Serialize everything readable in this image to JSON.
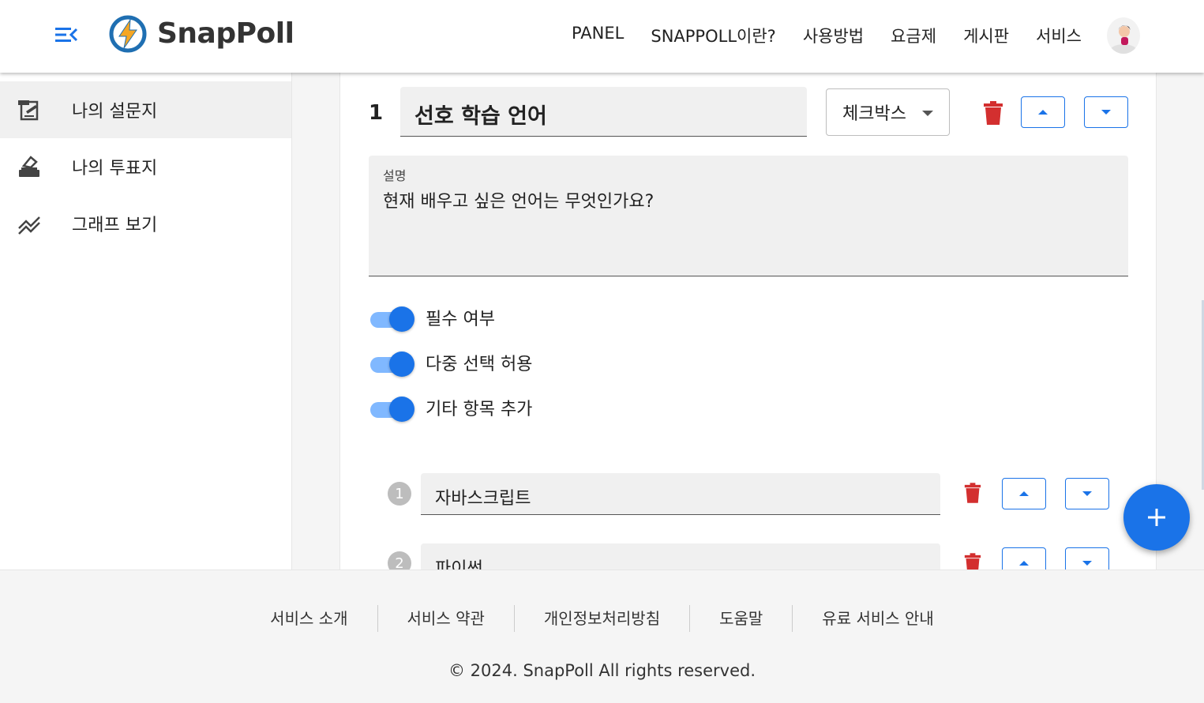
{
  "header": {
    "brand": "SnapPoll",
    "nav": [
      "PANEL",
      "SNAPPOLL이란?",
      "사용방법",
      "요금제",
      "게시판",
      "서비스"
    ]
  },
  "sidebar": {
    "items": [
      {
        "label": "나의 설문지",
        "icon": "survey-icon",
        "active": true
      },
      {
        "label": "나의 투표지",
        "icon": "ballot-icon",
        "active": false
      },
      {
        "label": "그래프 보기",
        "icon": "chart-icon",
        "active": false
      }
    ]
  },
  "question": {
    "number": "1",
    "title": "선호 학습 언어",
    "type": "체크박스",
    "description_label": "설명",
    "description": "현재 배우고 싶은 언어는 무엇인가요?",
    "toggles": [
      {
        "label": "필수 여부",
        "on": true
      },
      {
        "label": "다중 선택 허용",
        "on": true
      },
      {
        "label": "기타 항목 추가",
        "on": true
      }
    ],
    "options": [
      {
        "number": "1",
        "value": "자바스크립트"
      },
      {
        "number": "2",
        "value": "파이썬"
      }
    ]
  },
  "footer": {
    "links": [
      "서비스 소개",
      "서비스 약관",
      "개인정보처리방침",
      "도움말",
      "유료 서비스 안내"
    ],
    "copyright": "© 2024. SnapPoll All rights reserved."
  },
  "colors": {
    "accent": "#1a73e8",
    "toggle_track": "#80b8ff",
    "delete": "#d32f2f",
    "logo_orange": "#f5a623",
    "logo_blue": "#1f6fb2"
  }
}
